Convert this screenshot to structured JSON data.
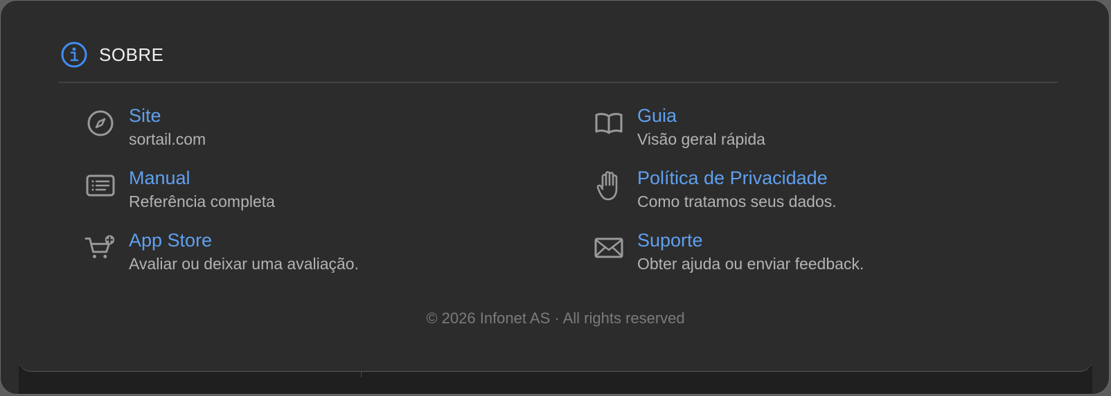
{
  "header": {
    "title": "SOBRE",
    "icon": "info-icon"
  },
  "items": [
    {
      "title": "Site",
      "subtitle": "sortail.com",
      "icon": "compass-icon"
    },
    {
      "title": "Guia",
      "subtitle": "Visão geral rápida",
      "icon": "book-icon"
    },
    {
      "title": "Manual",
      "subtitle": "Referência completa",
      "icon": "document-list-icon"
    },
    {
      "title": "Política de Privacidade",
      "subtitle": "Como tratamos seus dados.",
      "icon": "hand-icon"
    },
    {
      "title": "App Store",
      "subtitle": "Avaliar ou deixar uma avaliação.",
      "icon": "cart-plus-icon"
    },
    {
      "title": "Suporte",
      "subtitle": "Obter ajuda ou enviar feedback.",
      "icon": "envelope-icon"
    }
  ],
  "footer": {
    "copyright": "© 2026 Infonet AS · All rights reserved"
  },
  "colors": {
    "accent": "#5fa0f0",
    "info_icon": "#3f8ef5",
    "background": "#2c2c2c",
    "subtitle": "#b3b3b3",
    "footer": "#7b7b7b"
  }
}
